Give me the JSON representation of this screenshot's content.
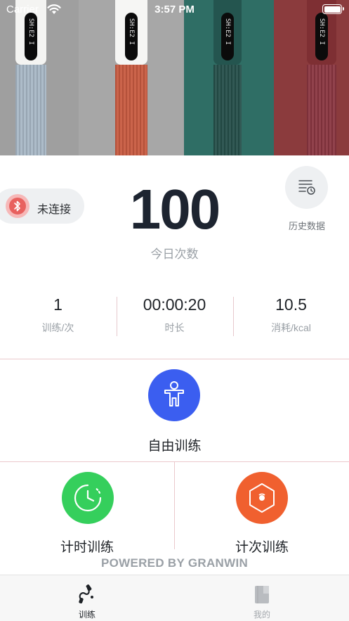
{
  "status_bar": {
    "carrier": "Carrier",
    "time": "3:57 PM"
  },
  "banner": {
    "rope_display_text": "SH:E2 I"
  },
  "device": {
    "connection_status": "未连接"
  },
  "today": {
    "count": "100",
    "count_label": "今日次数"
  },
  "history": {
    "label": "历史数据"
  },
  "metrics": [
    {
      "value": "1",
      "label": "训练/次"
    },
    {
      "value": "00:00:20",
      "label": "时长"
    },
    {
      "value": "10.5",
      "label": "消耗/kcal"
    }
  ],
  "modes": {
    "free": "自由训练",
    "timed": "计时训练",
    "counted": "计次训练"
  },
  "footer": {
    "powered_by": "POWERED BY GRANWIN"
  },
  "tabs": [
    {
      "label": "训练",
      "active": true
    },
    {
      "label": "我的",
      "active": false
    }
  ],
  "colors": {
    "free_mode": "#3b5ef0",
    "timed_mode": "#35cf5c",
    "counted_mode": "#f0602f",
    "bluetooth": "#e8615f",
    "divider": "#ebc8cc"
  }
}
